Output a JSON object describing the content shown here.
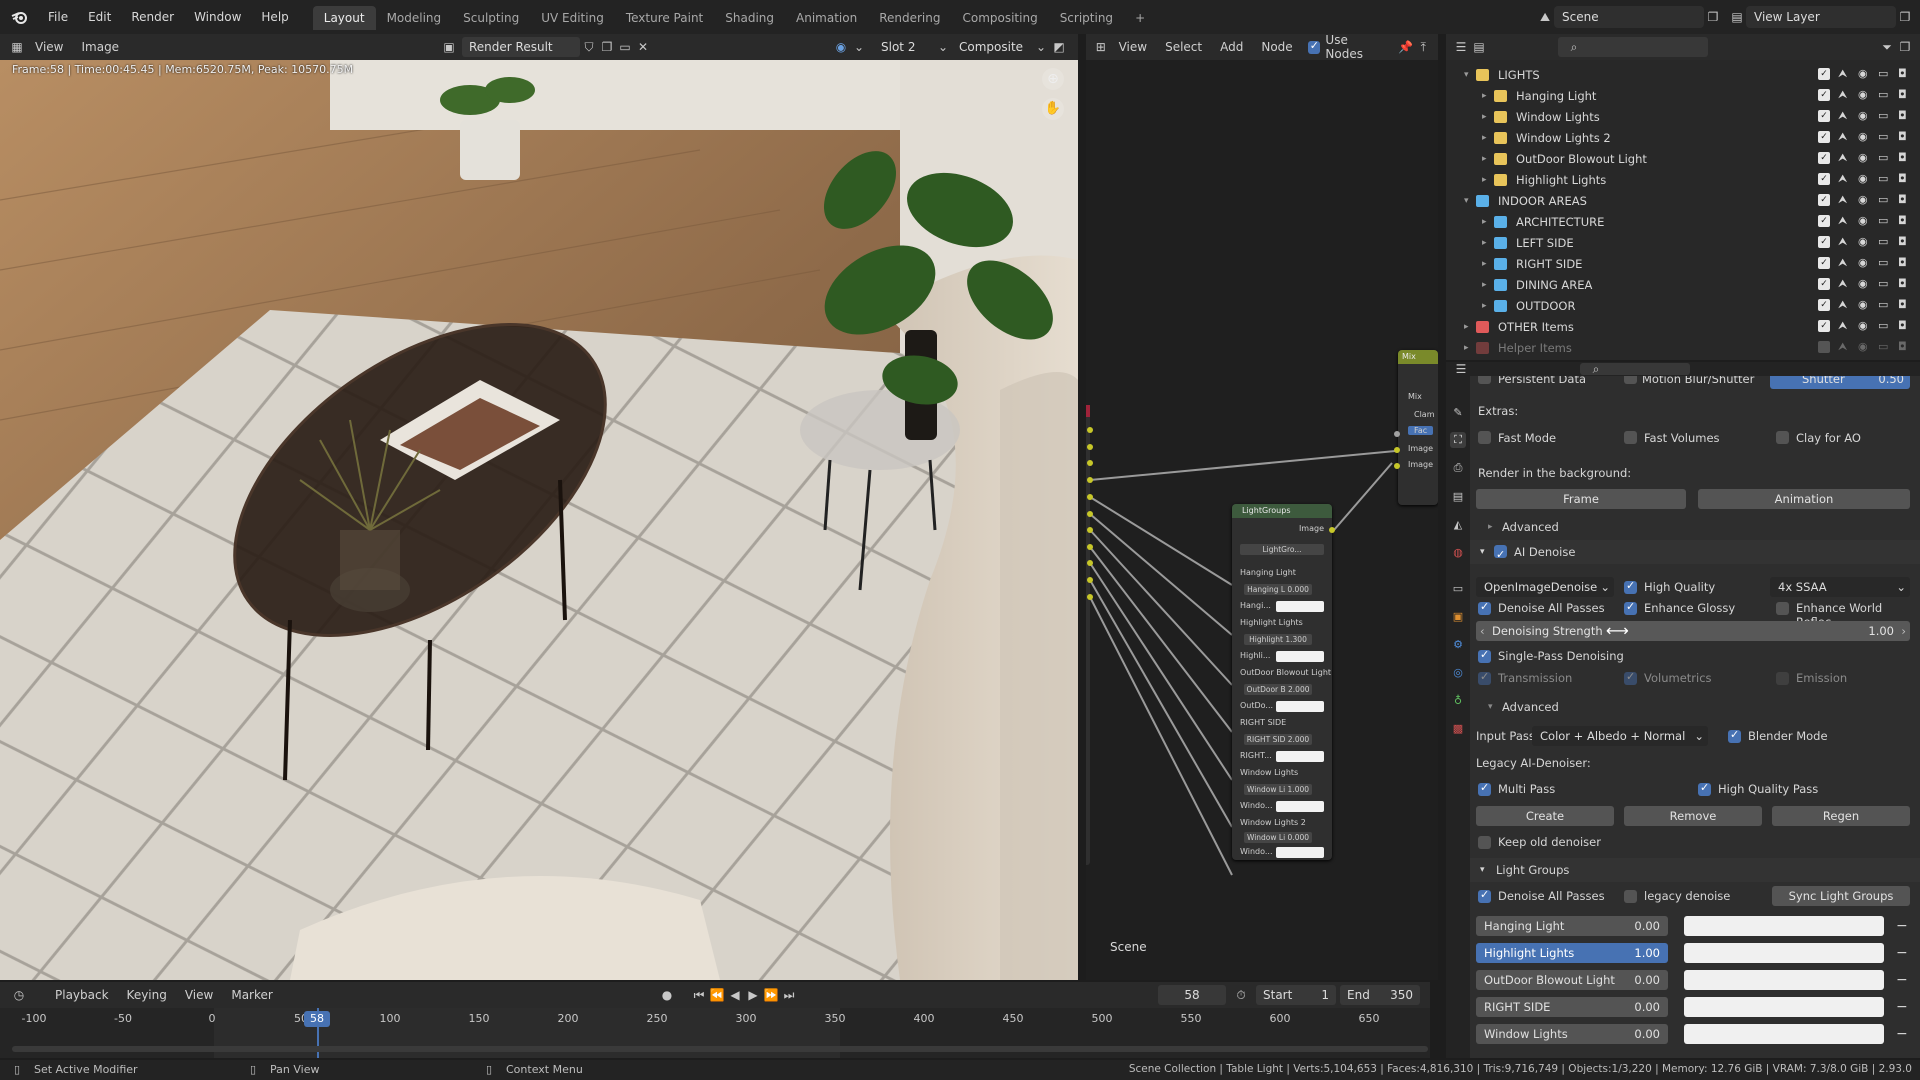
{
  "topbar": {
    "menus": [
      "File",
      "Edit",
      "Render",
      "Window",
      "Help"
    ],
    "workspaces": [
      "Layout",
      "Modeling",
      "Sculpting",
      "UV Editing",
      "Texture Paint",
      "Shading",
      "Animation",
      "Rendering",
      "Compositing",
      "Scripting"
    ],
    "active_workspace": "Layout",
    "add_tab": "+",
    "scene_label": "Scene",
    "view_layer_label": "View Layer"
  },
  "image_editor": {
    "menus": [
      "View",
      "Image"
    ],
    "image_name": "Render Result",
    "slot": "Slot 2",
    "pass": "Composite",
    "overlay_text": "Frame:58 | Time:00:45.45 | Mem:6520.75M, Peak: 10570.75M"
  },
  "node_editor": {
    "menus": [
      "View",
      "Select",
      "Add",
      "Node"
    ],
    "use_nodes_label": "Use Nodes",
    "scene_caption": "Scene",
    "mix_node": {
      "title": "Mix",
      "rows": [
        "Mix",
        "Clam",
        "Fac",
        "Image",
        "Image"
      ]
    },
    "lightgroups_node": {
      "title": "LightGroups",
      "output": "Image",
      "group_field": "LightGro...",
      "items": [
        {
          "label": "Hanging Light",
          "field": "Hanging L 0.000",
          "short": "Hangi..."
        },
        {
          "label": "Highlight Lights",
          "field": "Highlight  1.300",
          "short": "Highli..."
        },
        {
          "label": "OutDoor Blowout Light",
          "field": "OutDoor B 2.000",
          "short": "OutDo..."
        },
        {
          "label": "RIGHT SIDE",
          "field": "RIGHT SID 2.000",
          "short": "RIGHT..."
        },
        {
          "label": "Window Lights",
          "field": "Window Li 1.000",
          "short": "Windo..."
        },
        {
          "label": "Window Lights 2",
          "field": "Window Li 0.000",
          "short": "Windo..."
        }
      ]
    }
  },
  "outliner": {
    "rows": [
      {
        "label": "LIGHTS",
        "level": 0,
        "color": "#e8c45a",
        "expanded": true
      },
      {
        "label": "Hanging Light",
        "level": 1,
        "color": "#e8c45a"
      },
      {
        "label": "Window Lights",
        "level": 1,
        "color": "#e8c45a"
      },
      {
        "label": "Window Lights 2",
        "level": 1,
        "color": "#e8c45a"
      },
      {
        "label": "OutDoor Blowout Light",
        "level": 1,
        "color": "#e8c45a"
      },
      {
        "label": "Highlight Lights",
        "level": 1,
        "color": "#e8c45a"
      },
      {
        "label": "INDOOR AREAS",
        "level": 0,
        "color": "#5ab0e8",
        "expanded": true
      },
      {
        "label": "ARCHITECTURE",
        "level": 1,
        "color": "#5ab0e8"
      },
      {
        "label": "LEFT SIDE",
        "level": 1,
        "color": "#5ab0e8"
      },
      {
        "label": "RIGHT SIDE",
        "level": 1,
        "color": "#5ab0e8"
      },
      {
        "label": "DINING AREA",
        "level": 1,
        "color": "#5ab0e8"
      },
      {
        "label": "OUTDOOR",
        "level": 1,
        "color": "#5ab0e8"
      },
      {
        "label": "OTHER Items",
        "level": 0,
        "color": "#e05a5a",
        "expanded": false
      },
      {
        "label": "Helper Items",
        "level": 0,
        "color": "#e05a5a",
        "dim": true
      }
    ]
  },
  "properties": {
    "top_partial": [
      "Persistent Data",
      "Motion Blur/Shutter",
      "Shutter",
      "0.50"
    ],
    "extras_label": "Extras:",
    "extras": [
      "Fast Mode",
      "Fast Volumes",
      "Clay for AO"
    ],
    "bg_label": "Render in the background:",
    "frame_btn": "Frame",
    "animation_btn": "Animation",
    "advanced_label": "Advanced",
    "ai_denoise_label": "AI Denoise",
    "denoiser": "OpenImageDenoise",
    "high_quality": "High Quality",
    "ssaa": "4x SSAA",
    "denoise_all": "Denoise All Passes",
    "enhance_glossy": "Enhance Glossy",
    "enhance_world": "Enhance World Reflec...",
    "denoising_strength_label": "Denoising Strength",
    "denoising_strength_value": "1.00",
    "single_pass": "Single-Pass Denoising",
    "transmission": "Transmission",
    "volumetrics": "Volumetrics",
    "emission": "Emission",
    "advanced2_label": "Advanced",
    "input_pass_label": "Input Pass...",
    "input_pass_value": "Color + Albedo + Normal",
    "blender_mode": "Blender Mode",
    "legacy_label": "Legacy AI-Denoiser:",
    "multi_pass": "Multi Pass",
    "hq_pass": "High Quality Pass",
    "create_btn": "Create",
    "remove_btn": "Remove",
    "regen_btn": "Regen",
    "keep_old": "Keep old denoiser",
    "light_groups_label": "Light Groups",
    "lg_denoise_all": "Denoise All Passes",
    "legacy_denoise": "legacy denoise",
    "sync_btn": "Sync Light Groups",
    "light_groups": [
      {
        "name": "Hanging Light",
        "value": "0.00",
        "selected": false
      },
      {
        "name": "Highlight Lights",
        "value": "1.00",
        "selected": true
      },
      {
        "name": "OutDoor Blowout Light",
        "value": "0.00",
        "selected": false
      },
      {
        "name": "RIGHT SIDE",
        "value": "0.00",
        "selected": false
      },
      {
        "name": "Window Lights",
        "value": "0.00",
        "selected": false
      }
    ]
  },
  "timeline": {
    "menus": [
      "Playback",
      "Keying",
      "View",
      "Marker"
    ],
    "current_frame": "58",
    "start_label": "Start",
    "start": "1",
    "end_label": "End",
    "end": "350",
    "ticks": [
      "-100",
      "-50",
      "0",
      "50",
      "100",
      "150",
      "200",
      "250",
      "300",
      "350",
      "400",
      "450",
      "500",
      "550",
      "600",
      "650"
    ]
  },
  "statusbar": {
    "left": "Set Active Modifier",
    "middle": "Pan View",
    "context": "Context Menu",
    "right": "Scene Collection | Table Light | Verts:5,104,653 | Faces:4,816,310 | Tris:9,716,749 | Objects:1/3,220 | Memory: 12.76 GiB | VRAM: 7.3/8.0 GiB | 2.93.0"
  },
  "colors": {
    "accent": "#4772b3",
    "node_socket": "#c7c729",
    "lightgroups_header": "#3d5a3d"
  }
}
